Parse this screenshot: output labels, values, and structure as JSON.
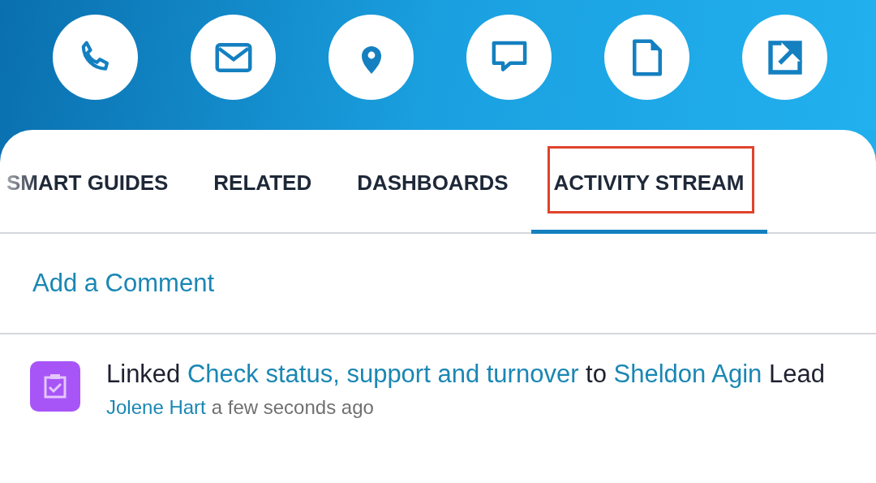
{
  "actions": [
    {
      "kind": "phone"
    },
    {
      "kind": "mail"
    },
    {
      "kind": "location"
    },
    {
      "kind": "chat"
    },
    {
      "kind": "document"
    },
    {
      "kind": "share"
    }
  ],
  "tabs": [
    {
      "label": "SMART GUIDES",
      "selected": false,
      "highlighted": false
    },
    {
      "label": "RELATED",
      "selected": false,
      "highlighted": false
    },
    {
      "label": "DASHBOARDS",
      "selected": false,
      "highlighted": false
    },
    {
      "label": "ACTIVITY STREAM",
      "selected": true,
      "highlighted": true
    }
  ],
  "comment_link": "Add a Comment",
  "activities": [
    {
      "parts": [
        {
          "kind": "text",
          "text": "Linked"
        },
        {
          "kind": "link",
          "text": "Check status, support and turnover"
        },
        {
          "kind": "text",
          "text": "to"
        },
        {
          "kind": "link",
          "text": "Sheldon Agin"
        },
        {
          "kind": "text",
          "text": "Lead"
        }
      ],
      "author": "Jolene Hart",
      "time": "a few seconds ago"
    }
  ]
}
